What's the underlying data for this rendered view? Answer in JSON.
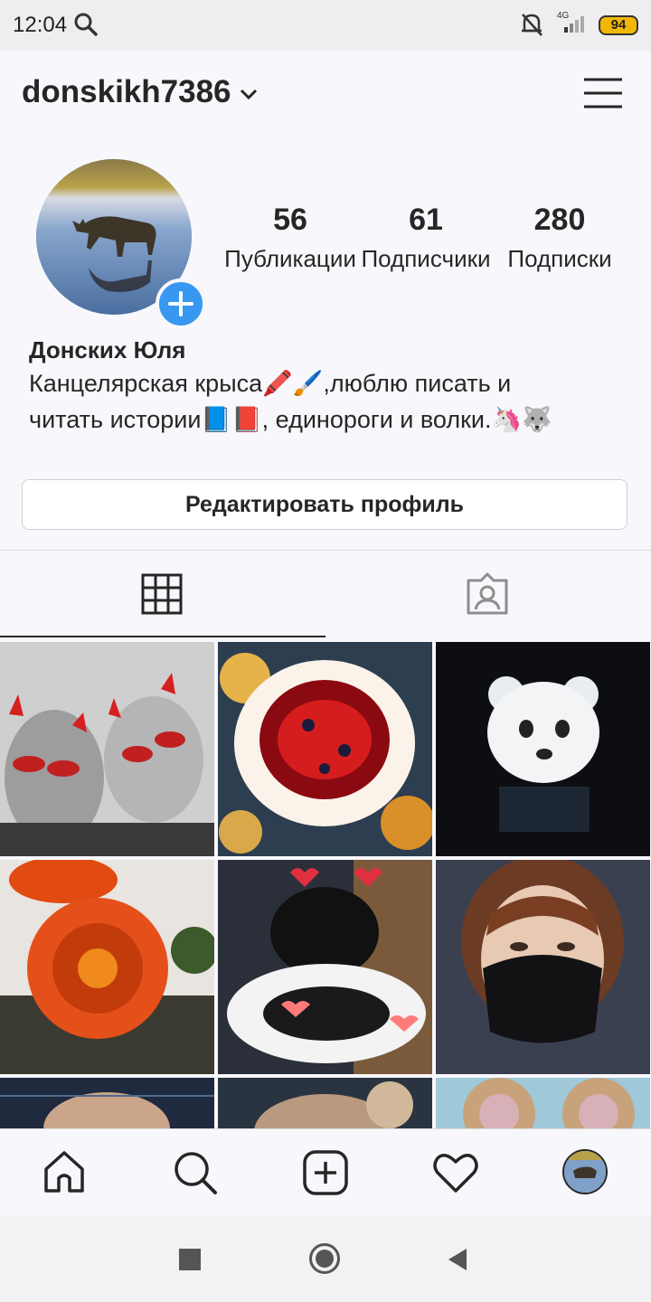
{
  "status_bar": {
    "time": "12:04",
    "network": "4G",
    "battery": "94",
    "icons": [
      "search-icon",
      "mute-bell-icon",
      "signal-icon",
      "battery-icon"
    ]
  },
  "header": {
    "username": "donskikh7386",
    "icons": [
      "chevron-down-icon",
      "menu-icon"
    ]
  },
  "profile": {
    "stats": [
      {
        "value": "56",
        "label": "Публикации"
      },
      {
        "value": "61",
        "label": "Подписчики"
      },
      {
        "value": "280",
        "label": "Подписки"
      }
    ],
    "full_name": "Донских Юля",
    "bio_lines": [
      "Канцелярская крыса🖍️🖌️,люблю писать и",
      "читать истории📘📕, единороги и волки.🦄🐺"
    ],
    "edit_button": "Редактировать профиль"
  },
  "tabs": [
    {
      "icon": "grid-icon",
      "active": true
    },
    {
      "icon": "tagged-icon",
      "active": false
    }
  ],
  "grid_posts": [
    "devil-horns-selfie",
    "berry-cake",
    "bear-lamp",
    "orange-flowers",
    "cat-with-hearts",
    "girl-in-mask",
    "partial-photo-1",
    "partial-photo-2",
    "partial-photo-3"
  ],
  "bottom_nav": [
    "home-icon",
    "search-icon",
    "add-post-icon",
    "heart-icon",
    "profile-avatar"
  ],
  "system_nav": [
    "recents-icon",
    "home-circle-icon",
    "back-icon"
  ],
  "colors": {
    "accent": "#3897f0",
    "text": "#262626",
    "background": "#f8f7fb"
  }
}
